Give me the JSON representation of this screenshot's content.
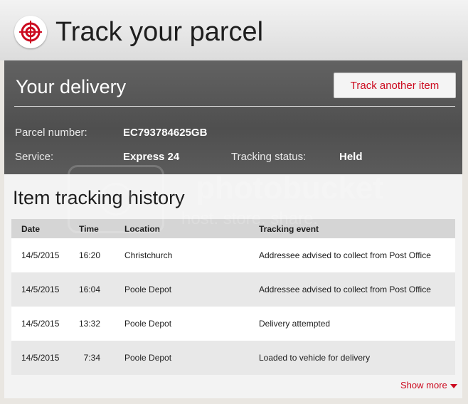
{
  "header": {
    "title": "Track your parcel",
    "logo_icon": "target-icon"
  },
  "delivery": {
    "title": "Your delivery",
    "track_button": "Track another item",
    "parcel_label": "Parcel number:",
    "parcel_value": "EC793784625GB",
    "service_label": "Service:",
    "service_value": "Express 24",
    "status_label": "Tracking status:",
    "status_value": "Held"
  },
  "history": {
    "title": "Item tracking history",
    "columns": [
      "Date",
      "Time",
      "Location",
      "Tracking event"
    ],
    "rows": [
      {
        "date": "14/5/2015",
        "time": "16:20",
        "location": "Christchurch",
        "event": "Addressee advised to collect from Post Office"
      },
      {
        "date": "14/5/2015",
        "time": "16:04",
        "location": "Poole Depot",
        "event": "Addressee advised to collect from Post Office"
      },
      {
        "date": "14/5/2015",
        "time": "13:32",
        "location": "Poole Depot",
        "event": "Delivery attempted"
      },
      {
        "date": "14/5/2015",
        "time": "7:34",
        "location": "Poole Depot",
        "event": "Loaded to vehicle for delivery"
      }
    ],
    "show_more": "Show more"
  },
  "watermark": {
    "text": "photobucket",
    "subtext": "host. store. share."
  },
  "colors": {
    "accent": "#cc0a1f",
    "panel": "#5a5a5a"
  }
}
